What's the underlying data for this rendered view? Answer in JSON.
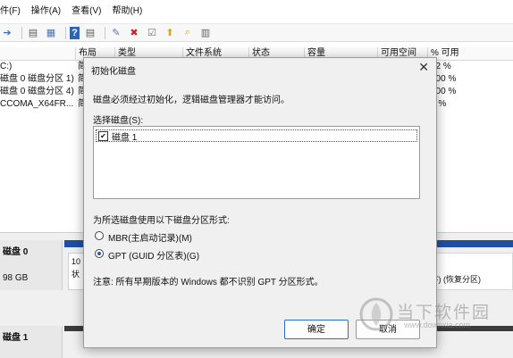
{
  "menu": {
    "items": [
      "件(F)",
      "操作(A)",
      "查看(V)",
      "帮助(H)"
    ]
  },
  "table": {
    "headers": [
      "布局",
      "类型",
      "文件系统",
      "状态",
      "容量",
      "可用空间",
      "% 可用"
    ],
    "rows": [
      {
        "name": "C:)",
        "layout": "简",
        "pct": "32 %"
      },
      {
        "name": "磁盘 0 磁盘分区 1)",
        "layout": "简",
        "pct": "100 %"
      },
      {
        "name": "磁盘 0 磁盘分区 4)",
        "layout": "简",
        "pct": "100 %"
      },
      {
        "name": "CCOMA_X64FR...",
        "layout": "简",
        "pct": "0 %"
      }
    ]
  },
  "bottom": {
    "disk0": {
      "label": "磁盘 0",
      "size": "98 GB",
      "part_text": "10",
      "part_status": "状"
    },
    "disk1": {
      "label": "磁盘 1"
    },
    "recovery": "F) (恢复分区)"
  },
  "dialog": {
    "title": "初始化磁盘",
    "description": "磁盘必须经过初始化，逻辑磁盘管理器才能访问。",
    "select_label": "选择磁盘(S):",
    "disk_item": "磁盘 1",
    "disk_checked": true,
    "style_label": "为所选磁盘使用以下磁盘分区形式:",
    "mbr_label": "MBR(主启动记录)(M)",
    "gpt_label": "GPT (GUID 分区表)(G)",
    "selected_style": "GPT",
    "note": "注意: 所有早期版本的 Windows 都不识别 GPT 分区形式。",
    "ok_label": "确定",
    "cancel_label": "取消"
  },
  "watermark": {
    "title": "当下软件园",
    "url": "www.downxia.com"
  }
}
